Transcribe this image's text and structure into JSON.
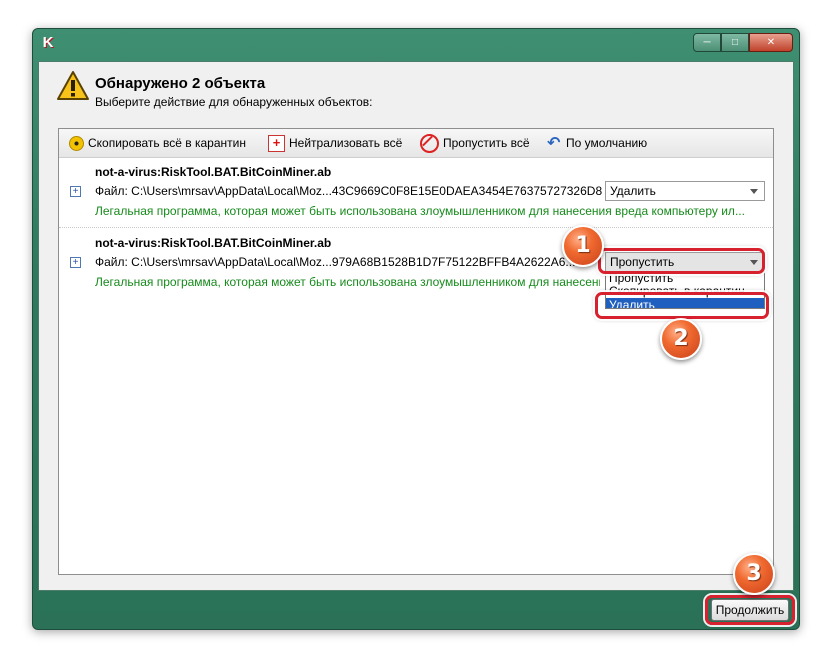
{
  "window": {
    "app_icon": "K",
    "controls": {
      "minimize": "minimize-icon",
      "maximize": "maximize-icon",
      "close": "close-icon"
    }
  },
  "header": {
    "title": "Обнаружено 2 объекта",
    "subtitle": "Выберите действие для обнаруженных объектов:",
    "icon": "warning-icon"
  },
  "toolbar": {
    "quarantine_all": "Скопировать всё в карантин",
    "neutralize_all": "Нейтрализовать всё",
    "skip_all": "Пропустить всё",
    "default": "По умолчанию"
  },
  "objects": [
    {
      "name": "not-a-virus:RiskTool.BAT.BitCoinMiner.ab",
      "file": "Файл: C:\\Users\\mrsav\\AppData\\Local\\Moz...43C9669C0F8E15E0DAEA3454E76375727326D8",
      "description": "Легальная программа, которая может быть использована злоумышленником для нанесения вреда компьютеру ил...",
      "action": "Удалить"
    },
    {
      "name": "not-a-virus:RiskTool.BAT.BitCoinMiner.ab",
      "file": "Файл: C:\\Users\\mrsav\\AppData\\Local\\Moz...979A68B1528B1D7F75122BFFB4A2622A6...B",
      "description": "Легальная программа, которая может быть использована злоумышленником для нанесения вреда...",
      "action": "Пропустить",
      "options": [
        "Пропустить",
        "Скопировать в карантин",
        "Удалить"
      ],
      "highlighted_option": "Удалить"
    }
  ],
  "buttons": {
    "continue": "Продолжить"
  },
  "callouts": [
    "1",
    "2",
    "3"
  ],
  "colors": {
    "window_frame": "#2f7a5f",
    "description_text": "#178a1c",
    "highlight": "#d8212e",
    "badge": "#f06a30",
    "selected_option": "#1f5fbf"
  }
}
